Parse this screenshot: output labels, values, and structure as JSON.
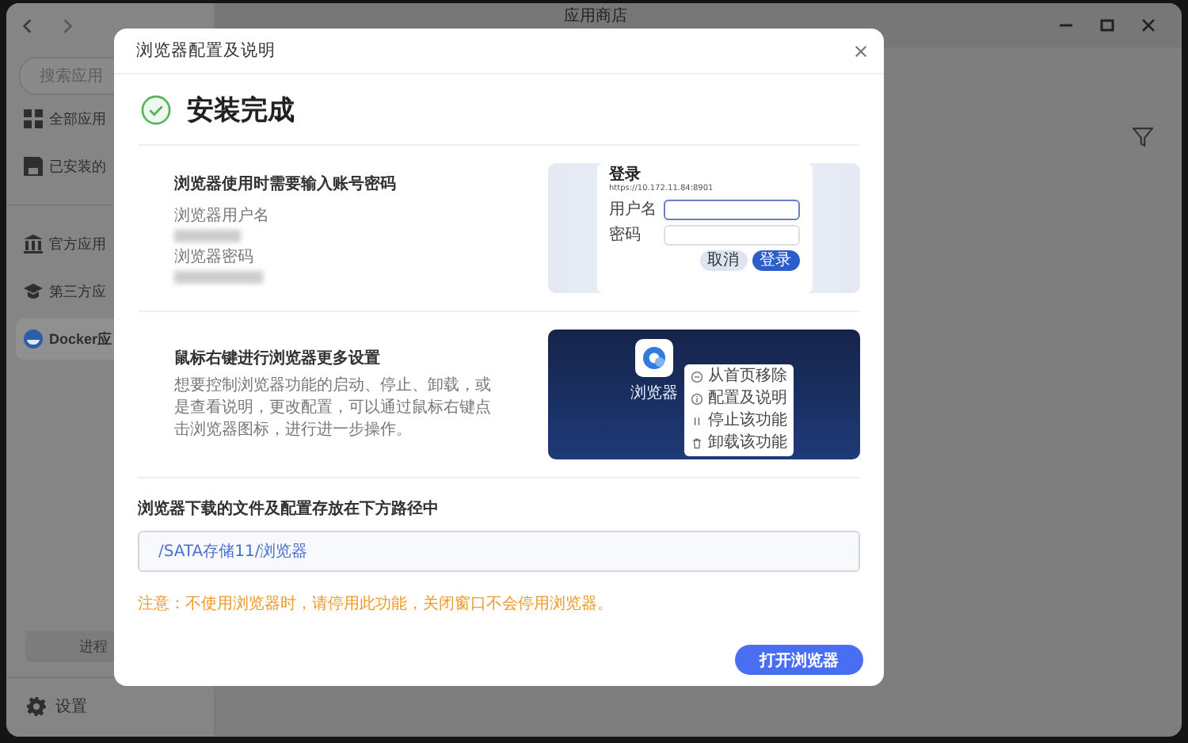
{
  "window": {
    "title": "应用商店"
  },
  "sidebar": {
    "search": {
      "placeholder": "搜索应用"
    },
    "items": [
      {
        "label": "全部应用",
        "selected": false
      },
      {
        "label": "已安装的",
        "selected": false
      },
      {
        "label": "官方应用",
        "selected": false
      },
      {
        "label": "第三方应",
        "selected": false
      },
      {
        "label": "Docker应",
        "selected": true
      }
    ],
    "process_button": "进程",
    "settings": "设置"
  },
  "dialog": {
    "title": "浏览器配置及说明",
    "status": "安装完成",
    "sections": [
      {
        "kind": "credentials",
        "title": "浏览器使用时需要输入账号密码",
        "fields": [
          {
            "label": "浏览器用户名"
          },
          {
            "label": "浏览器密码"
          }
        ],
        "preview": {
          "title": "登录",
          "url": "https://10.172.11.84:8901",
          "fields": [
            "用户名",
            "密码"
          ],
          "buttons": [
            "取消",
            "登录"
          ]
        }
      },
      {
        "kind": "menu",
        "title": "鼠标右键进行浏览器更多设置",
        "description": "想要控制浏览器功能的启动、停止、卸载，或是查看说明，更改配置，可以通过鼠标右键点击浏览器图标，进行进一步操作。",
        "preview": {
          "app_label": "浏览器",
          "menu_items": [
            "从首页移除",
            "配置及说明",
            "停止该功能",
            "卸载该功能"
          ]
        }
      }
    ],
    "path": {
      "label": "浏览器下载的文件及配置存放在下方路径中",
      "value": "/SATA存储11/浏览器"
    },
    "warning": "注意：不使用浏览器时，请停用此功能，关闭窗口不会停用浏览器。",
    "button": "打开浏览器"
  }
}
